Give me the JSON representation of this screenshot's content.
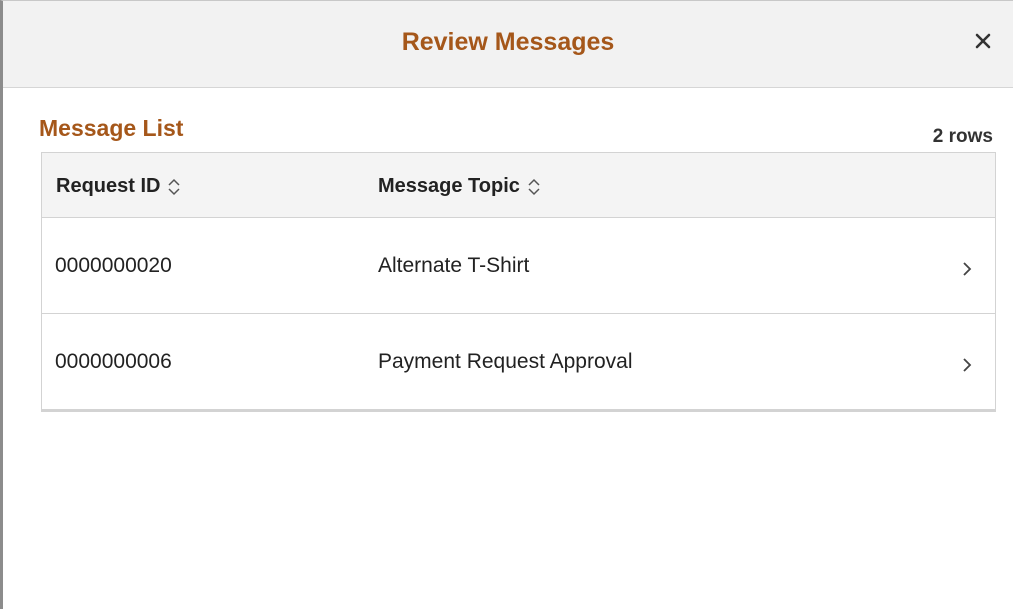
{
  "dialog": {
    "title": "Review Messages",
    "close_icon": "close-icon"
  },
  "section": {
    "title": "Message List",
    "row_count": "2 rows"
  },
  "grid": {
    "columns": [
      {
        "label": "Request ID",
        "sortable": true
      },
      {
        "label": "Message Topic",
        "sortable": true
      }
    ],
    "rows": [
      {
        "request_id": "0000000020",
        "topic": "Alternate T-Shirt"
      },
      {
        "request_id": "0000000006",
        "topic": "Payment Request Approval"
      }
    ]
  },
  "colors": {
    "accent": "#a5571a",
    "header_bg": "#f2f2f2",
    "grid_header_bg": "#f4f4f4",
    "border": "#d3d3d3"
  }
}
